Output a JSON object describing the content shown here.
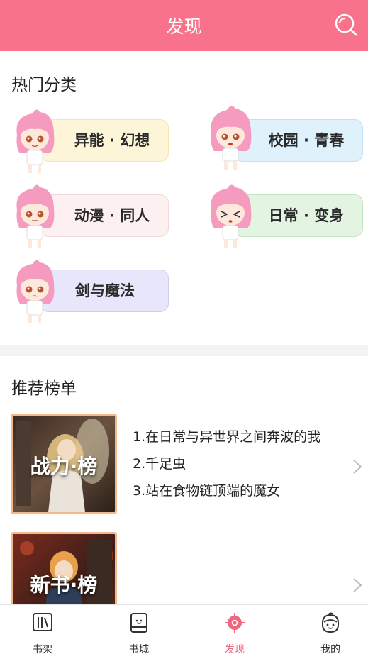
{
  "header": {
    "title": "发现"
  },
  "hot_categories": {
    "title": "热门分类",
    "items": [
      {
        "label": "异能 · 幻想",
        "pill_color": "#fdf5d7",
        "border_color": "#f4e6b3"
      },
      {
        "label": "校园 · 青春",
        "pill_color": "#dff2fc",
        "border_color": "#bfe2f5"
      },
      {
        "label": "动漫 · 同人",
        "pill_color": "#fdf0f0",
        "border_color": "#f5d9da"
      },
      {
        "label": "日常 · 变身",
        "pill_color": "#e3f5e2",
        "border_color": "#c3e6c1"
      },
      {
        "label": "剑与魔法",
        "pill_color": "#e7e6fa",
        "border_color": "#cfcdf1"
      }
    ]
  },
  "rankings": {
    "title": "推荐榜单",
    "lists": [
      {
        "label": "战力·榜",
        "items": [
          "1.在日常与异世界之间奔波的我",
          "2.千足虫",
          "3.站在食物链顶端的魔女"
        ]
      },
      {
        "label": "新书·榜",
        "items": []
      }
    ]
  },
  "tabbar": {
    "tabs": [
      {
        "label": "书架",
        "icon": "bookshelf-icon"
      },
      {
        "label": "书城",
        "icon": "bookstore-icon"
      },
      {
        "label": "发现",
        "icon": "discover-icon",
        "active": true
      },
      {
        "label": "我的",
        "icon": "profile-icon"
      }
    ]
  },
  "colors": {
    "accent": "#f7728a",
    "active_tab": "#f0687f"
  }
}
